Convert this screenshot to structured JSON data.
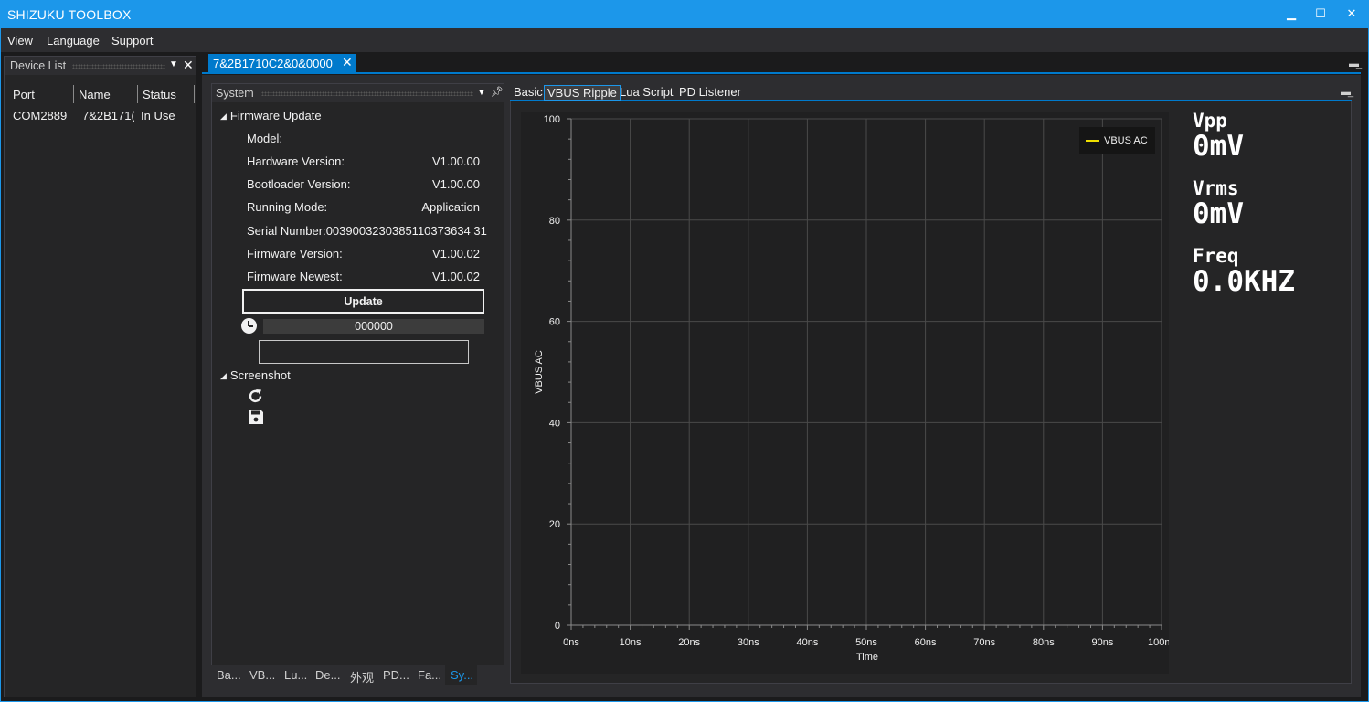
{
  "window": {
    "title": "SHIZUKU TOOLBOX",
    "minimize": "▁",
    "maximize": "☐",
    "close": "✕"
  },
  "menu": [
    "View",
    "Language",
    "Support"
  ],
  "device_list": {
    "title": "Device List",
    "columns": [
      "Port",
      "Name",
      "Status"
    ],
    "rows": [
      {
        "port": "COM2889",
        "name": "7&2B171(",
        "status": "In Use"
      }
    ]
  },
  "document_tab": {
    "label": "7&2B1710C2&0&0000",
    "close": "✕"
  },
  "system_panel": {
    "title": "System",
    "firmware_section": "Firmware Update",
    "fields": [
      {
        "label": "Model:",
        "value": ""
      },
      {
        "label": "Hardware Version:",
        "value": "V1.00.00"
      },
      {
        "label": "Bootloader Version:",
        "value": "V1.00.00"
      },
      {
        "label": "Running Mode:",
        "value": "Application"
      },
      {
        "label": "Serial Number:",
        "value": "0039003230385110373634 31"
      },
      {
        "label": "Firmware Version:",
        "value": "V1.00.02"
      },
      {
        "label": "Firmware Newest:",
        "value": "V1.00.02"
      }
    ],
    "serial_full": "Serial Number:0039003230385110373634 31",
    "update_button": "Update",
    "progress_text": "000000",
    "progress_fraction": 0,
    "status_text": "",
    "screenshot_section": "Screenshot",
    "bottom_tabs": [
      "Ba...",
      "VB...",
      "Lu...",
      "De...",
      "外观",
      "PD...",
      "Fa...",
      "Sy..."
    ],
    "active_bottom_tab": 7
  },
  "right_tabs": {
    "items": [
      "Basic",
      "VBUS Ripple",
      "Lua Script",
      "PD Listener"
    ],
    "active": 1
  },
  "readouts": {
    "vpp_label": "Vpp",
    "vpp_value": "0mV",
    "vrms_label": "Vrms",
    "vrms_value": "0mV",
    "freq_label": "Freq",
    "freq_value": "0.0KHZ"
  },
  "colors": {
    "accent": "#1c97ea",
    "series": "#f0e000",
    "background": "#1b1b1c"
  },
  "chart_data": {
    "type": "line",
    "xlabel": "Time",
    "ylabel": "VBUS AC",
    "x_ticks": [
      "0ns",
      "10ns",
      "20ns",
      "30ns",
      "40ns",
      "50ns",
      "60ns",
      "70ns",
      "80ns",
      "90ns",
      "100ns"
    ],
    "y_ticks": [
      "0",
      "20",
      "40",
      "60",
      "80",
      "100"
    ],
    "xlim": [
      0,
      100
    ],
    "ylim": [
      0,
      100
    ],
    "grid": true,
    "legend": "top-right",
    "series": [
      {
        "name": "VBUS AC",
        "color": "#f0e000",
        "x": [],
        "y": []
      }
    ]
  }
}
